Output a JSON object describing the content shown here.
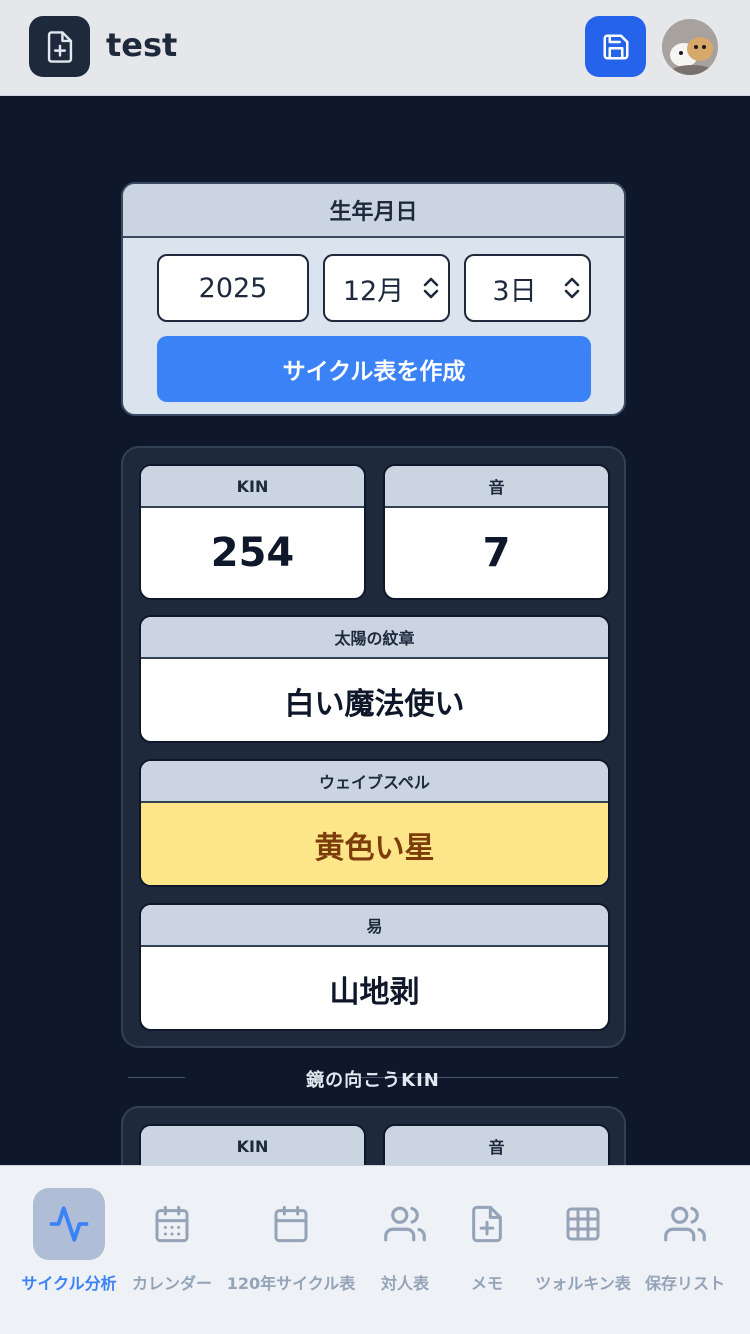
{
  "header": {
    "title": "test"
  },
  "date_form": {
    "title": "生年月日",
    "year": "2025",
    "month": "12月",
    "day": "3日",
    "create_label": "サイクル表を作成"
  },
  "result": {
    "kin_label": "KIN",
    "kin_value": "254",
    "tone_label": "音",
    "tone_value": "7",
    "seal_label": "太陽の紋章",
    "seal_value": "白い魔法使い",
    "wavespell_label": "ウェイブスペル",
    "wavespell_value": "黄色い星",
    "iching_label": "易",
    "iching_value": "山地剥"
  },
  "mirror": {
    "heading": "鏡の向こうKIN",
    "kin_label": "KIN",
    "tone_label": "音"
  },
  "nav": [
    {
      "label": "サイクル分析",
      "icon": "activity-icon",
      "active": true
    },
    {
      "label": "カレンダー",
      "icon": "calendar-grid-icon",
      "active": false
    },
    {
      "label": "120年サイクル表",
      "icon": "calendar-icon",
      "active": false
    },
    {
      "label": "対人表",
      "icon": "users-icon",
      "active": false
    },
    {
      "label": "メモ",
      "icon": "file-plus-icon",
      "active": false
    },
    {
      "label": "ツォルキン表",
      "icon": "grid-icon",
      "active": false
    },
    {
      "label": "保存リスト",
      "icon": "users-icon",
      "active": false
    }
  ],
  "colors": {
    "accent": "#3b82f6",
    "background": "#0f172a",
    "highlight": "#fde68a"
  }
}
